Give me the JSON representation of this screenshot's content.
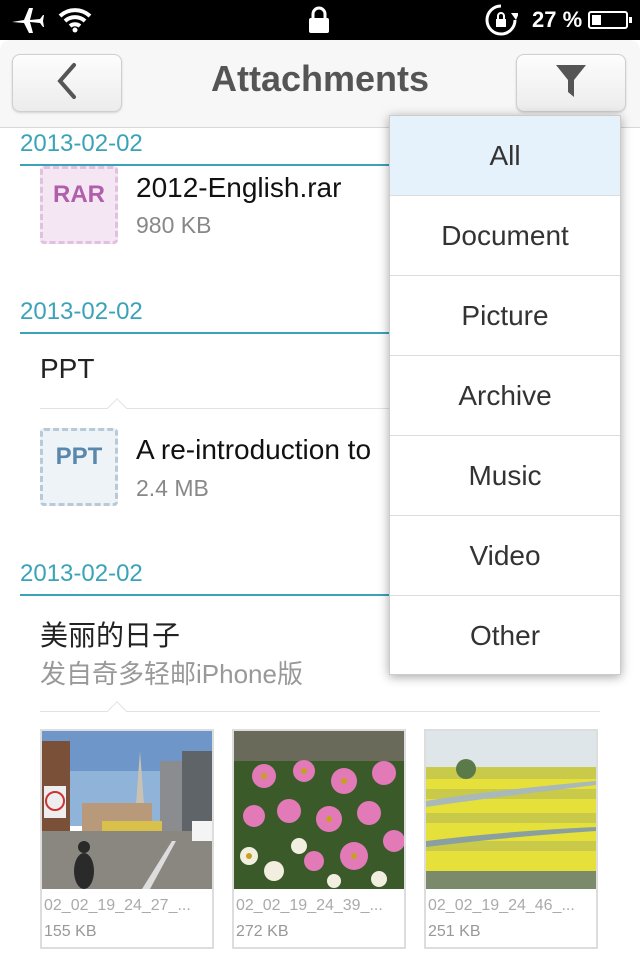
{
  "status_bar": {
    "airplane_icon": "airplane-icon",
    "wifi_icon": "wifi-icon",
    "lock_icon": "lock-icon",
    "rotation_lock_icon": "rotation-lock-icon",
    "battery_percent": "27 %",
    "battery_level": 0.27
  },
  "nav": {
    "title": "Attachments",
    "back_icon": "chevron-left-icon",
    "filter_icon": "filter-icon"
  },
  "groups": [
    {
      "date": "2013-02-02",
      "file": {
        "icon_label": "RAR",
        "name": "2012-English.rar",
        "size": "980 KB"
      }
    },
    {
      "date": "2013-02-02",
      "subject": "PPT",
      "file": {
        "icon_label": "PPT",
        "name": "A re-introduction to",
        "size": "2.4 MB"
      }
    },
    {
      "date": "2013-02-02",
      "subject": "美丽的日子",
      "subtitle": "发自奇多轻邮iPhone版",
      "images": [
        {
          "name": "02_02_19_24_27_...",
          "size": "155 KB"
        },
        {
          "name": "02_02_19_24_39_...",
          "size": "272 KB"
        },
        {
          "name": "02_02_19_24_46_...",
          "size": "251 KB"
        }
      ]
    }
  ],
  "filter_menu": {
    "selected": "All",
    "items": [
      "All",
      "Document",
      "Picture",
      "Archive",
      "Music",
      "Video",
      "Other"
    ]
  },
  "colors": {
    "accent": "#3aa3b8",
    "selected_bg": "#e5f1fb"
  }
}
